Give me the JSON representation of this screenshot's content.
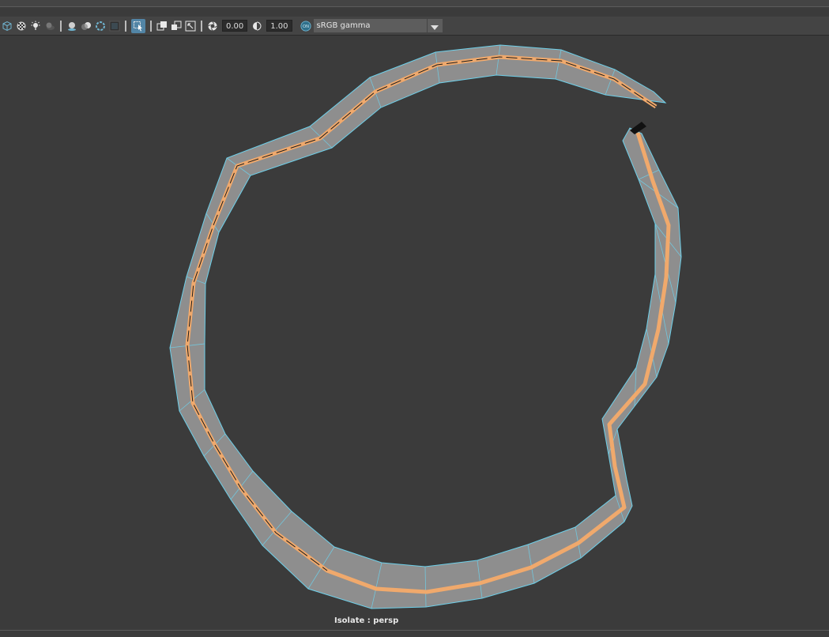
{
  "toolbar": {
    "icons": [
      "wireframe-cube-icon",
      "checker-texture-icon",
      "light-bulb-icon",
      "shadow-icon",
      "ambient-occlusion-icon",
      "motion-blur-icon",
      "anti-aliasing-icon",
      "depth-of-field-icon",
      "isolate-select-icon",
      "xray-icon",
      "xray-joints-icon",
      "xray-active-icon",
      "exposure-icon",
      "gamma-icon",
      "color-management-icon",
      "dropdown-arrow-icon"
    ],
    "exposure_value": "0.00",
    "gamma_value": "1.00",
    "color_space": "sRGB gamma",
    "colors": {
      "active_bg": "#5285a6",
      "field_bg": "#2b2b2b",
      "select_bg": "#5d5d5d"
    }
  },
  "viewport": {
    "mesh_icon": "curved-ribbon-mesh",
    "colors": {
      "background": "#3b3b3b",
      "mesh_face": "#8e8e8e",
      "edge_highlight": "#6ed0ea",
      "curve": "#f0a96c"
    }
  },
  "status": {
    "isolate_label": "Isolate : persp"
  }
}
